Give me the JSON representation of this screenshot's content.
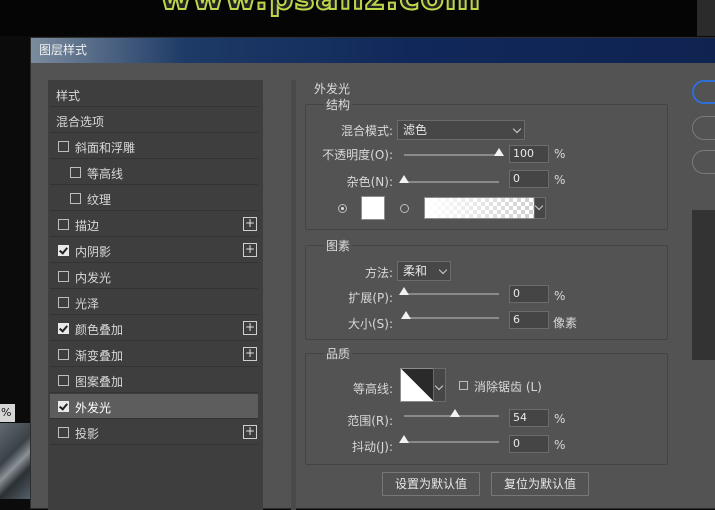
{
  "watermark": "www.psahz.com",
  "bg_zoom_label": "%",
  "dialog": {
    "title": "图层样式"
  },
  "style_list": [
    {
      "label": "样式",
      "checkbox": false,
      "checked": false,
      "indent": 0,
      "plus": false,
      "active": false
    },
    {
      "label": "混合选项",
      "checkbox": false,
      "checked": false,
      "indent": 0,
      "plus": false,
      "active": false
    },
    {
      "label": "斜面和浮雕",
      "checkbox": true,
      "checked": false,
      "indent": 0,
      "plus": false,
      "active": false
    },
    {
      "label": "等高线",
      "checkbox": true,
      "checked": false,
      "indent": 1,
      "plus": false,
      "active": false
    },
    {
      "label": "纹理",
      "checkbox": true,
      "checked": false,
      "indent": 1,
      "plus": false,
      "active": false
    },
    {
      "label": "描边",
      "checkbox": true,
      "checked": false,
      "indent": 0,
      "plus": true,
      "active": false
    },
    {
      "label": "内阴影",
      "checkbox": true,
      "checked": true,
      "indent": 0,
      "plus": true,
      "active": false
    },
    {
      "label": "内发光",
      "checkbox": true,
      "checked": false,
      "indent": 0,
      "plus": false,
      "active": false
    },
    {
      "label": "光泽",
      "checkbox": true,
      "checked": false,
      "indent": 0,
      "plus": false,
      "active": false
    },
    {
      "label": "颜色叠加",
      "checkbox": true,
      "checked": true,
      "indent": 0,
      "plus": true,
      "active": false
    },
    {
      "label": "渐变叠加",
      "checkbox": true,
      "checked": false,
      "indent": 0,
      "plus": true,
      "active": false
    },
    {
      "label": "图案叠加",
      "checkbox": true,
      "checked": false,
      "indent": 0,
      "plus": false,
      "active": false
    },
    {
      "label": "外发光",
      "checkbox": true,
      "checked": true,
      "indent": 0,
      "plus": false,
      "active": true
    },
    {
      "label": "投影",
      "checkbox": true,
      "checked": false,
      "indent": 0,
      "plus": true,
      "active": false
    }
  ],
  "outer_glow": {
    "title": "外发光",
    "structure": {
      "title": "结构",
      "blend_mode_label": "混合模式:",
      "blend_mode_value": "滤色",
      "opacity_label": "不透明度(O):",
      "opacity_value": "100",
      "opacity_unit": "%",
      "opacity_fraction": 1.0,
      "noise_label": "杂色(N):",
      "noise_value": "0",
      "noise_unit": "%",
      "noise_fraction": 0.0,
      "color_selected": "solid",
      "glow_color": "#ffffff"
    },
    "elements": {
      "title": "图素",
      "technique_label": "方法:",
      "technique_value": "柔和",
      "spread_label": "扩展(P):",
      "spread_value": "0",
      "spread_unit": "%",
      "spread_fraction": 0.0,
      "size_label": "大小(S):",
      "size_value": "6",
      "size_unit": "像素",
      "size_fraction": 0.024
    },
    "quality": {
      "title": "品质",
      "contour_label": "等高线:",
      "antialias_label": "消除锯齿 (L)",
      "antialias_checked": false,
      "range_label": "范围(R):",
      "range_value": "54",
      "range_unit": "%",
      "range_fraction": 0.54,
      "jitter_label": "抖动(J):",
      "jitter_value": "0",
      "jitter_unit": "%",
      "jitter_fraction": 0.0
    },
    "buttons": {
      "make_default": "设置为默认值",
      "reset_default": "复位为默认值"
    }
  }
}
